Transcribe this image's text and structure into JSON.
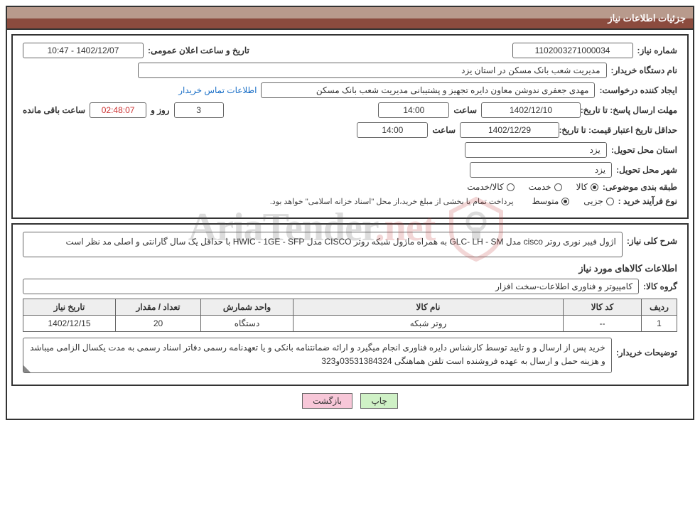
{
  "header": {
    "title": "جزئیات اطلاعات نیاز"
  },
  "info": {
    "need_no_label": "شماره نیاز:",
    "need_no": "1102003271000034",
    "announce_label": "تاریخ و ساعت اعلان عمومی:",
    "announce": "1402/12/07 - 10:47",
    "buyer_org_label": "نام دستگاه خریدار:",
    "buyer_org": "مدیریت شعب بانک مسکن در استان یزد",
    "requester_label": "ایجاد کننده درخواست:",
    "requester": "مهدی جعفری ندوشن معاون دایره تجهیز و پشتیبانی مدیریت شعب بانک مسکن",
    "contact_link": "اطلاعات تماس خریدار",
    "deadline_label": "مهلت ارسال پاسخ: تا تاریخ:",
    "deadline_date": "1402/12/10",
    "time_label": "ساعت",
    "deadline_time": "14:00",
    "days_left": "3",
    "days_word": "روز و",
    "countdown": "02:48:07",
    "remain_text": "ساعت باقی مانده",
    "validity_label": "حداقل تاریخ اعتبار قیمت: تا تاریخ:",
    "validity_date": "1402/12/29",
    "validity_time": "14:00",
    "province_label": "استان محل تحویل:",
    "province": "یزد",
    "city_label": "شهر محل تحویل:",
    "city": "یزد",
    "subject_type_label": "طبقه بندی موضوعی:",
    "subj_goods": "کالا",
    "subj_service": "خدمت",
    "subj_both": "کالا/خدمت",
    "purchase_type_label": "نوع فرآیند خرید :",
    "pt_small": "جزیی",
    "pt_medium": "متوسط",
    "purchase_note": "پرداخت تمام یا بخشی از مبلغ خرید،از محل \"اسناد خزانه اسلامی\" خواهد بود."
  },
  "need": {
    "general_label": "شرح کلی نیاز:",
    "general_text": "اژول فیبر نوری روتر cisco مدل GLC- LH - SM به همراه ماژول شبکه روتر CISCO مدل HWIC - 1GE - SFP با حداقل یک سال گارانتی و اصلی مد نظر است",
    "items_heading": "اطلاعات کالاهای مورد نیاز",
    "group_label": "گروه کالا:",
    "group": "کامپیوتر و فناوری اطلاعات-سخت افزار",
    "table": {
      "h_row": "ردیف",
      "h_code": "کد کالا",
      "h_name": "نام کالا",
      "h_unit": "واحد شمارش",
      "h_qty": "تعداد / مقدار",
      "h_date": "تاریخ نیاز",
      "rows": [
        {
          "row": "1",
          "code": "--",
          "name": "روتر شبکه",
          "unit": "دستگاه",
          "qty": "20",
          "date": "1402/12/15"
        }
      ]
    },
    "buyer_desc_label": "توضیحات خریدار:",
    "buyer_desc": "خرید پس از ارسال و و تایید توسط کارشناس دایره فناوری انجام میگیرد و ارائه ضمانتنامه بانکی و یا تعهدنامه رسمی دفاتر اسناد رسمی به مدت یکسال الزامی میباشد و هزینه حمل و ارسال به عهده فروشنده است تلفن هماهنگی 03531384324و323"
  },
  "buttons": {
    "print": "چاپ",
    "back": "بازگشت"
  },
  "watermark": {
    "text_pre": "AriaTender",
    "text_dot": ".",
    "text_net": "net"
  }
}
